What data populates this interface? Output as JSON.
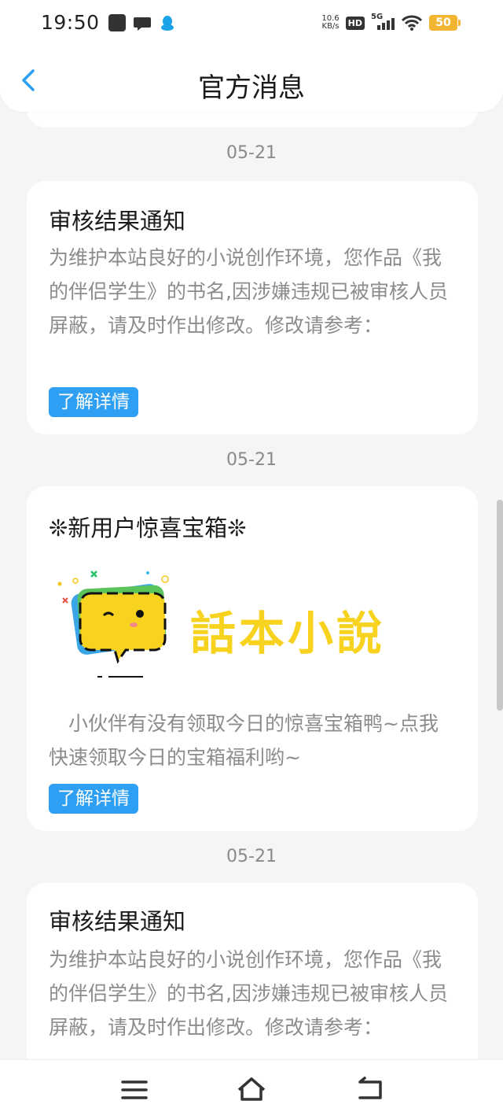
{
  "status_bar": {
    "time": "19:50",
    "net_speed_value": "10.6",
    "net_speed_unit": "KB/s",
    "hd_badge": "HD",
    "network_type": "5G",
    "battery": "50",
    "icons": [
      "app-notification-icon",
      "chat-icon",
      "qq-penguin-icon",
      "wifi-icon",
      "signal-icon",
      "battery-icon"
    ]
  },
  "header": {
    "title": "官方消息",
    "back_icon": "back-arrow-icon"
  },
  "messages": [
    {
      "date": "05-21",
      "title": "审核结果通知",
      "body": "为维护本站良好的小说创作环境，您作品《我的伴侣学生》的书名,因涉嫌违规已被审核人员屏蔽，请及时作出修改。修改请参考：",
      "button": "了解详情"
    },
    {
      "date": "05-21",
      "title": "❊新用户惊喜宝箱❊",
      "banner_text": "話本小說",
      "body": "　小伙伴有没有领取今日的惊喜宝箱鸭~点我快速领取今日的宝箱福利哟~",
      "button": "了解详情"
    },
    {
      "date": "05-21",
      "title": "审核结果通知",
      "body": "为维护本站良好的小说创作环境，您作品《我的伴侣学生》的书名,因涉嫌违规已被审核人员屏蔽，请及时作出修改。修改请参考："
    }
  ],
  "nav_bar": {
    "icons": [
      "menu-icon",
      "home-icon",
      "back-icon"
    ]
  },
  "colors": {
    "accent": "#2e9ff2",
    "background": "#f6f4f6",
    "banner_yellow": "#f7d21e"
  }
}
